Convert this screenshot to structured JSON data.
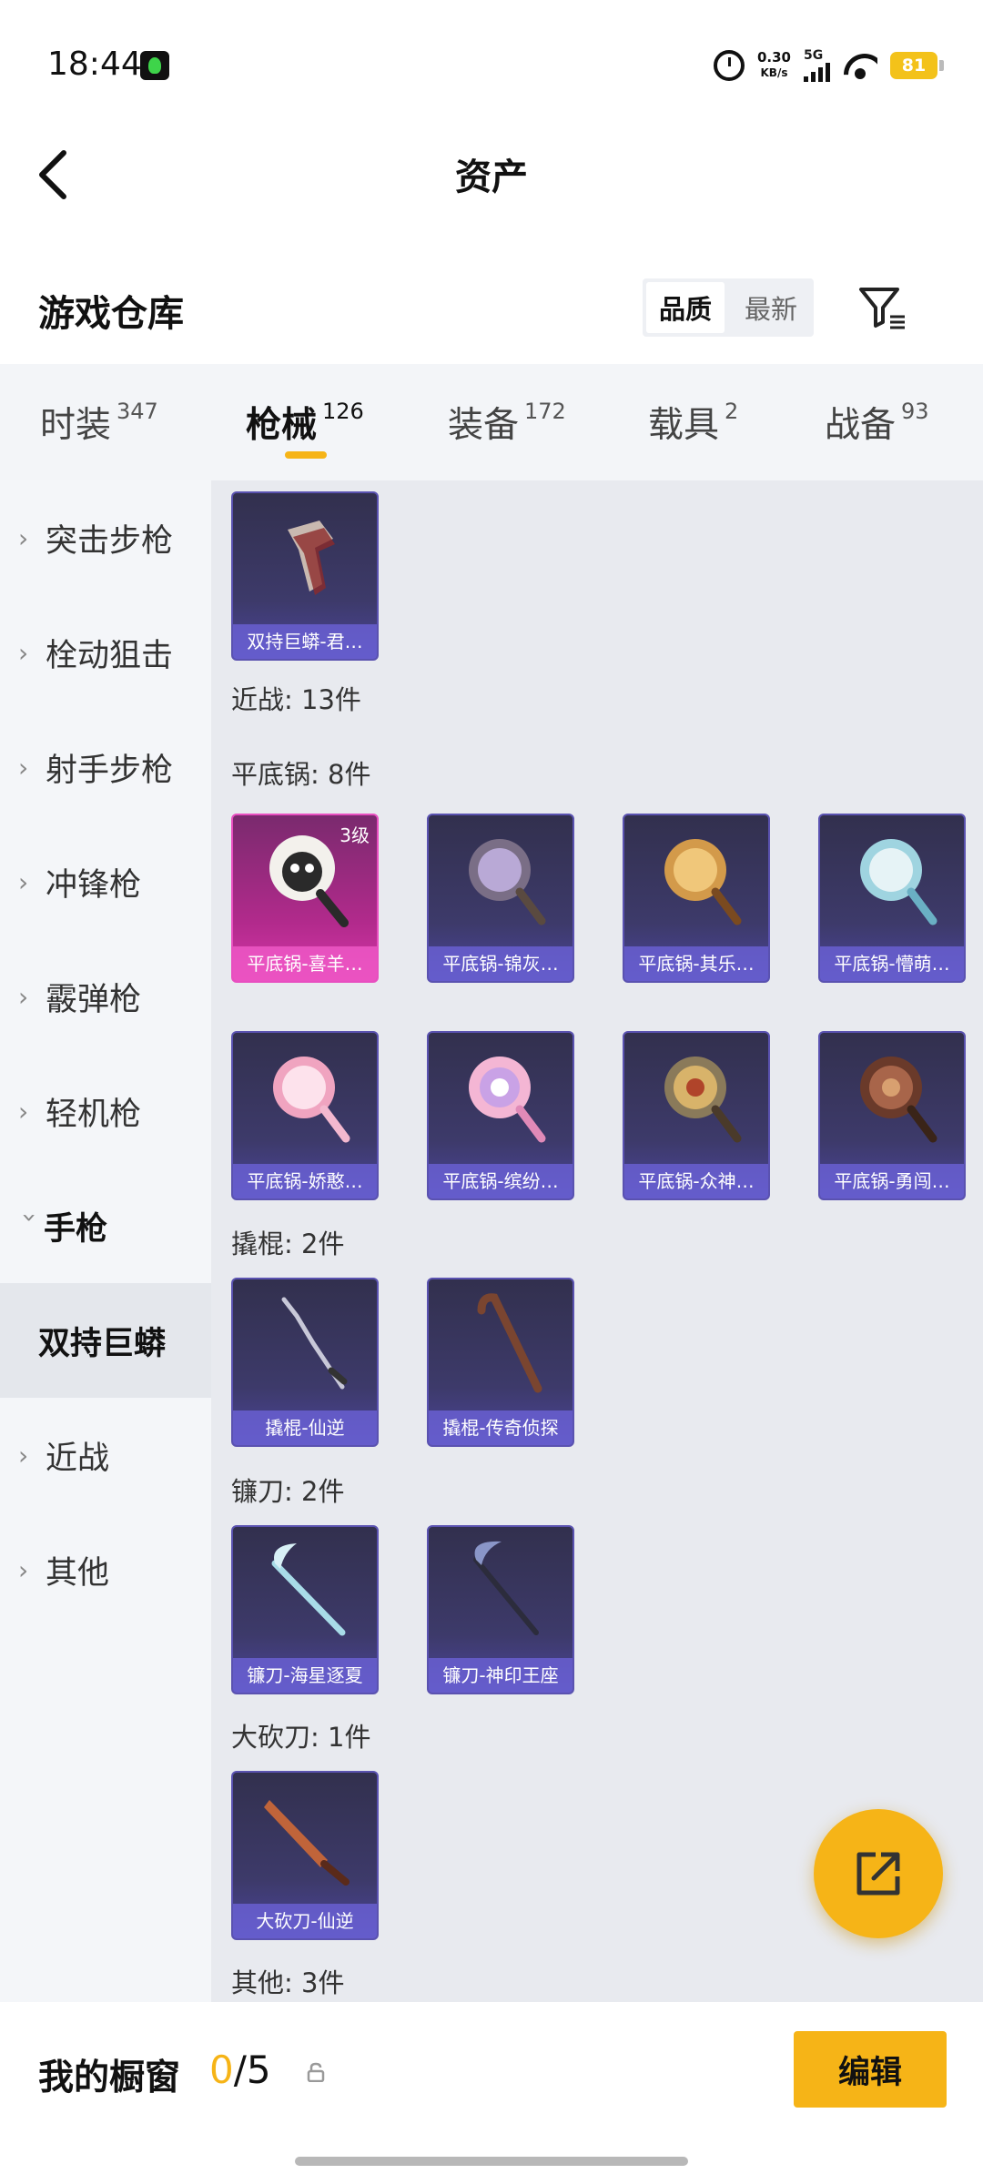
{
  "status_bar": {
    "time": "18:44",
    "speed_value": "0.30",
    "speed_unit": "KB/s",
    "network": "5G",
    "battery": "81"
  },
  "header": {
    "title": "资产"
  },
  "warehouse": {
    "title": "游戏仓库",
    "sort_options": [
      "品质",
      "最新"
    ],
    "active_sort": "品质"
  },
  "tabs": [
    {
      "label": "时装",
      "count": "347"
    },
    {
      "label": "枪械",
      "count": "126"
    },
    {
      "label": "装备",
      "count": "172"
    },
    {
      "label": "载具",
      "count": "2"
    },
    {
      "label": "战备",
      "count": "93"
    }
  ],
  "active_tab": "枪械",
  "sidebar": {
    "items": [
      {
        "label": "突击步枪"
      },
      {
        "label": "栓动狙击"
      },
      {
        "label": "射手步枪"
      },
      {
        "label": "冲锋枪"
      },
      {
        "label": "霰弹枪"
      },
      {
        "label": "轻机枪"
      },
      {
        "label": "手枪"
      },
      {
        "label": "双持巨蟒"
      },
      {
        "label": "近战"
      },
      {
        "label": "其他"
      }
    ],
    "selected": "双持巨蟒"
  },
  "content": {
    "top_item": {
      "name": "双持巨蟒-君…"
    },
    "sections": [
      {
        "label": "近战: 13件"
      },
      {
        "label": "平底锅: 8件"
      },
      {
        "label": "撬棍: 2件"
      },
      {
        "label": "镰刀: 2件"
      },
      {
        "label": "大砍刀: 1件"
      },
      {
        "label": "其他: 3件"
      }
    ],
    "pans": [
      {
        "name": "平底锅-喜羊…",
        "level": "3级"
      },
      {
        "name": "平底锅-锦灰…"
      },
      {
        "name": "平底锅-其乐…"
      },
      {
        "name": "平底锅-懵萌…"
      },
      {
        "name": "平底锅-娇憨…"
      },
      {
        "name": "平底锅-缤纷…"
      },
      {
        "name": "平底锅-众神…"
      },
      {
        "name": "平底锅-勇闯…"
      }
    ],
    "crowbars": [
      {
        "name": "撬棍-仙逆"
      },
      {
        "name": "撬棍-传奇侦探"
      }
    ],
    "scythes": [
      {
        "name": "镰刀-海星逐夏"
      },
      {
        "name": "镰刀-神印王座"
      }
    ],
    "machetes": [
      {
        "name": "大砍刀-仙逆"
      }
    ]
  },
  "bottom_bar": {
    "showcase_label": "我的橱窗",
    "showcase_current": "0",
    "showcase_total": "/5",
    "edit_label": "编辑"
  },
  "icons": {
    "back": "back-chevron-icon",
    "filter": "filter-icon",
    "share": "share-external-icon",
    "lock": "lock-icon"
  },
  "colors": {
    "accent": "#f6b417",
    "card_base": "#3d3a6a",
    "card_highlight": "#d636a8"
  }
}
